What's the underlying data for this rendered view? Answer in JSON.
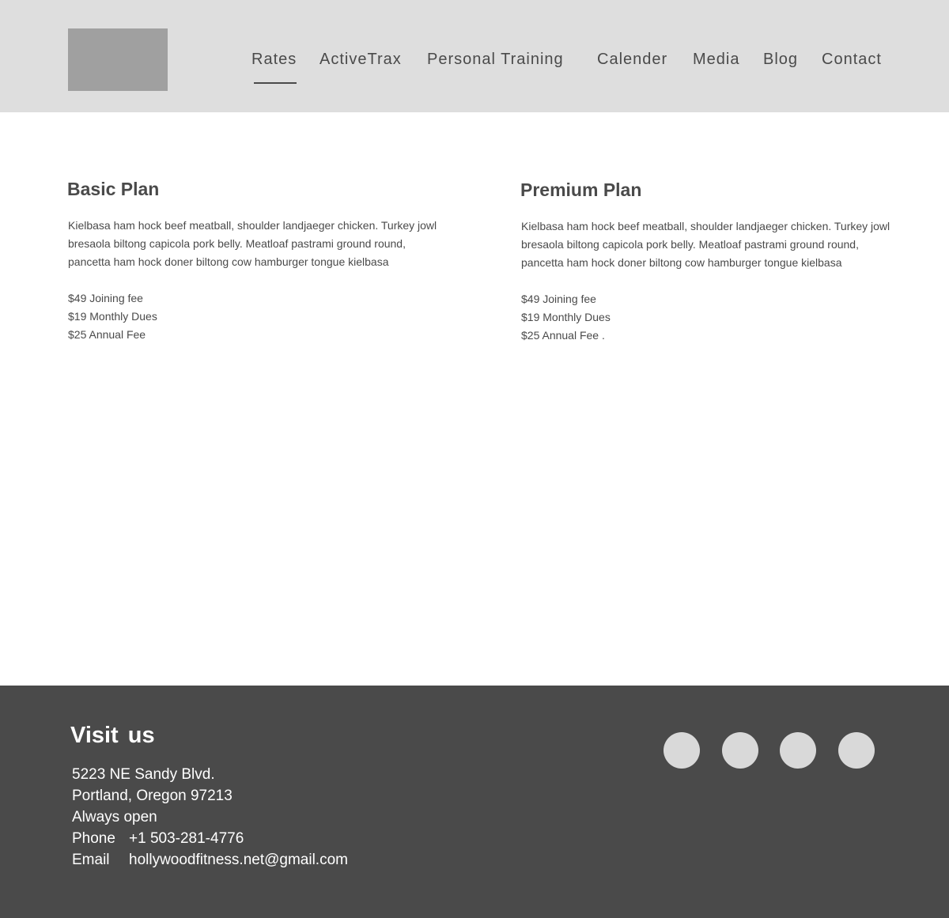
{
  "nav": {
    "items": [
      {
        "label": "Rates"
      },
      {
        "label": "ActiveTrax"
      },
      {
        "label": "Personal Training"
      },
      {
        "label": "Calender"
      },
      {
        "label": "Media"
      },
      {
        "label": "Blog"
      },
      {
        "label": "Contact"
      }
    ],
    "active": "Rates"
  },
  "plans": [
    {
      "title": "Basic Plan",
      "description": "Kielbasa ham hock beef meatball, shoulder landjaeger chicken. Turkey jowl bresaola biltong capicola pork belly. Meatloaf pastrami ground round, pancetta ham hock doner biltong cow hamburger tongue kielbasa",
      "prices": [
        "$49 Joining fee",
        "$19 Monthly Dues",
        "$25 Annual Fee"
      ]
    },
    {
      "title": "Premium Plan",
      "description": "Kielbasa ham hock beef meatball, shoulder landjaeger chicken. Turkey jowl bresaola biltong capicola pork belly. Meatloaf pastrami ground round, pancetta ham hock doner biltong cow hamburger tongue kielbasa",
      "prices": [
        "$49 Joining fee",
        "$19 Monthly Dues",
        "$25 Annual Fee ."
      ]
    }
  ],
  "footer": {
    "title": "Visit  us",
    "address_line1": "5223 NE Sandy Blvd.",
    "address_line2": "Portland, Oregon 97213",
    "hours": "Always open",
    "phone_label": "Phone",
    "phone": "+1 503-281-4776",
    "email_label": "Email",
    "email": "hollywoodfitness.net@gmail.com",
    "social_icons": [
      "social-icon-1",
      "social-icon-2",
      "social-icon-3",
      "social-icon-4"
    ]
  },
  "colors": {
    "header_bg": "#dedede",
    "logo_placeholder": "#a0a0a0",
    "text": "#4a4a4a",
    "footer_bg": "#4a4a4a",
    "footer_text": "#ffffff",
    "social_circle": "#d9d9d9"
  }
}
